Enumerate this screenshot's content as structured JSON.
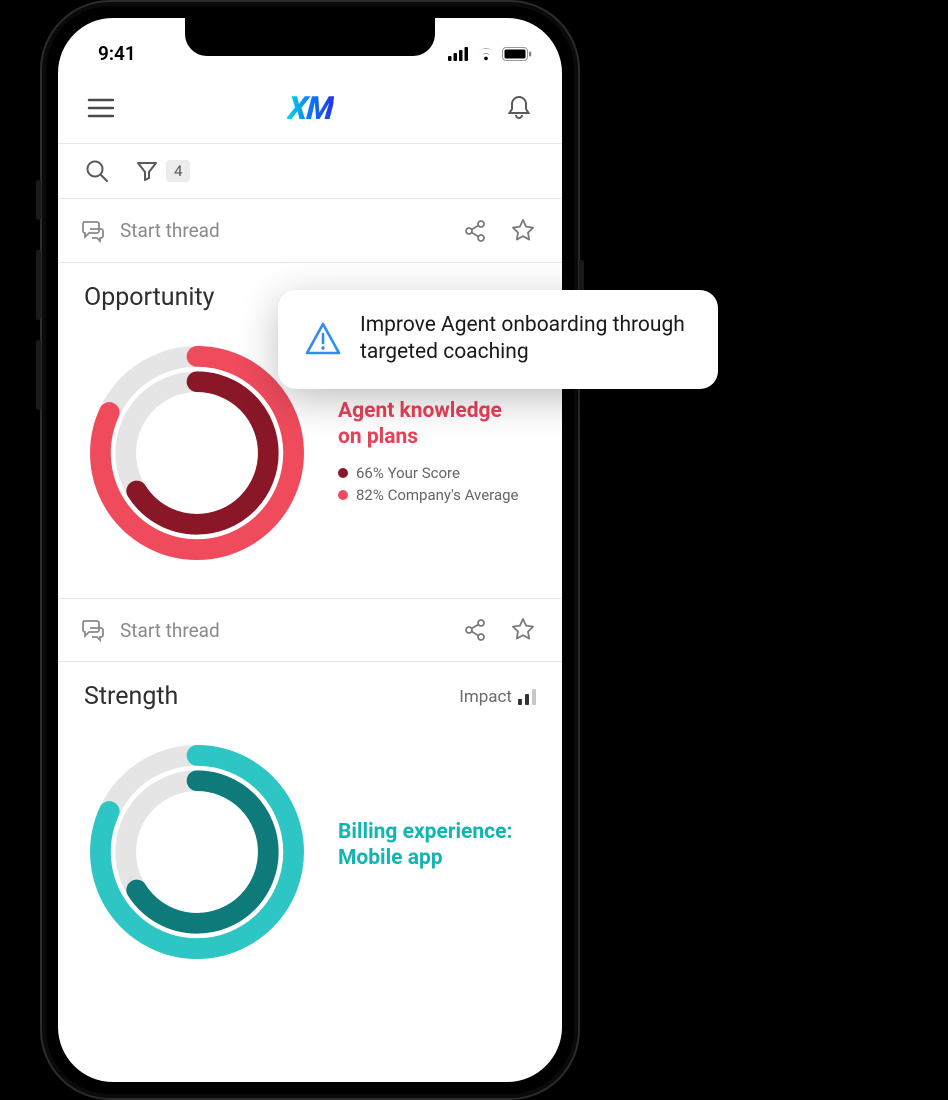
{
  "status_bar": {
    "time": "9:41"
  },
  "app_header": {
    "logo_text": "XM"
  },
  "toolbar": {
    "filter_count": "4"
  },
  "thread_row": {
    "placeholder": "Start thread"
  },
  "sections": {
    "opportunity": {
      "title": "Opportunity",
      "metric_title_a": "Agent knowledge",
      "metric_title_b": "on plans",
      "legend_score": "66% Your Score",
      "legend_avg": "82% Company's Average"
    },
    "strength": {
      "title": "Strength",
      "impact_label": "Impact",
      "metric_title_a": "Billing experience:",
      "metric_title_b": "Mobile app"
    }
  },
  "callout": {
    "text": "Improve Agent onboarding through targeted coaching"
  },
  "chart_data": [
    {
      "type": "pie",
      "title": "Agent knowledge on plans",
      "series": [
        {
          "name": "Your Score",
          "values": [
            66
          ],
          "color": "#8a1728"
        },
        {
          "name": "Company's Average",
          "values": [
            82
          ],
          "color": "#ef4b5d"
        }
      ]
    },
    {
      "type": "pie",
      "title": "Billing experience: Mobile app",
      "series": [
        {
          "name": "Your Score",
          "values": [
            66
          ],
          "color": "#0e7b7a"
        },
        {
          "name": "Company's Average",
          "values": [
            82
          ],
          "color": "#2dc6c4"
        }
      ]
    }
  ],
  "colors": {
    "opportunity_outer": "#ef4b5d",
    "opportunity_inner": "#8a1728",
    "strength_outer": "#2dc6c4",
    "strength_inner": "#0e7b7a",
    "callout_icon": "#2f8eed"
  }
}
